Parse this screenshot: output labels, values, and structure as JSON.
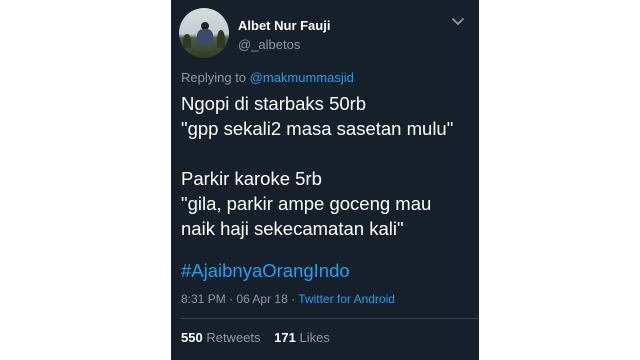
{
  "author": {
    "name": "Albet Nur Fauji",
    "handle": "@_albetos"
  },
  "reply": {
    "prefix": "Replying to",
    "handle": "@makmummasjid"
  },
  "tweet": {
    "lines": [
      "Ngopi di starbaks 50rb",
      "\"gpp sekali2 masa sasetan mulu\"",
      "Parkir karoke 5rb",
      "\"gila, parkir ampe goceng mau",
      "naik haji sekecamatan kali\""
    ],
    "hashtag": "#AjaibnyaOrangIndo"
  },
  "meta": {
    "time": "8:31 PM",
    "separator1": "·",
    "date": "06 Apr 18",
    "separator2": "·",
    "source": "Twitter for Android"
  },
  "stats": {
    "retweets_count": "550",
    "retweets_label": "Retweets",
    "likes_count": "171",
    "likes_label": "Likes"
  },
  "colors": {
    "background": "#15202b",
    "text": "#ffffff",
    "muted": "#8899a6",
    "link": "#1da1f2"
  },
  "icons": {
    "menu": "chevron-down-icon"
  }
}
